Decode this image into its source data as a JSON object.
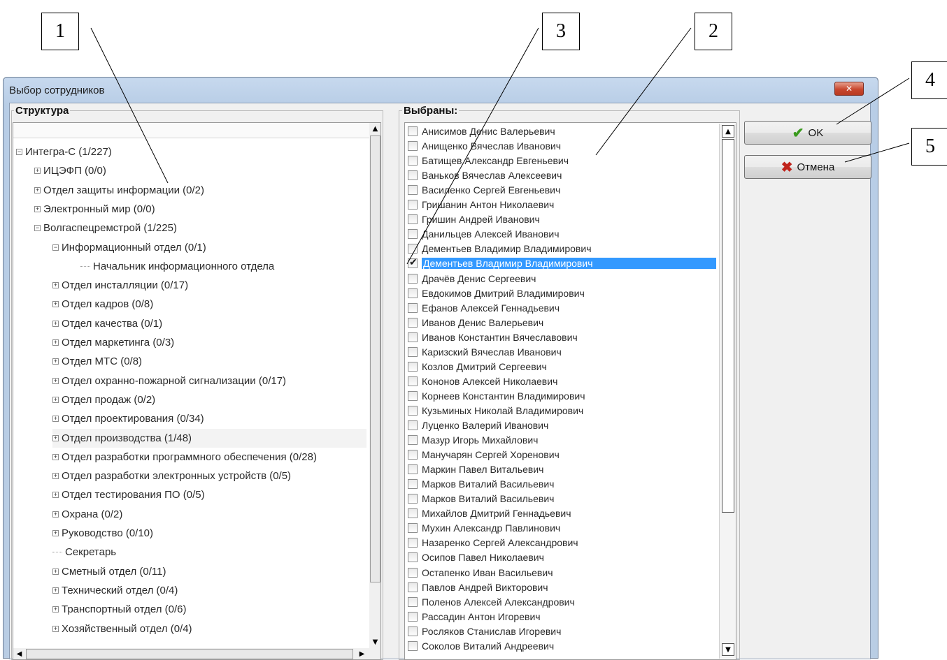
{
  "window": {
    "title": "Выбор сотрудников",
    "close_glyph": "✕"
  },
  "structure": {
    "label": "Структура",
    "items": [
      {
        "text": "Интегра-С (1/227)",
        "level": 0,
        "kind": "minus"
      },
      {
        "text": "ИЦЭФП (0/0)",
        "level": 1,
        "kind": "plus"
      },
      {
        "text": "Отдел  защиты информации (0/2)",
        "level": 1,
        "kind": "plus"
      },
      {
        "text": "Электронный мир (0/0)",
        "level": 1,
        "kind": "plus"
      },
      {
        "text": "Волгаспецремстрой (1/225)",
        "level": 1,
        "kind": "minus"
      },
      {
        "text": "Информационный отдел (0/1)",
        "level": 2,
        "kind": "minus"
      },
      {
        "text": "Начальник информационного отдела",
        "level": 3,
        "kind": "leaf"
      },
      {
        "text": "Отдел инсталляции (0/17)",
        "level": 2,
        "kind": "plus"
      },
      {
        "text": "Отдел кадров (0/8)",
        "level": 2,
        "kind": "plus"
      },
      {
        "text": "Отдел качества (0/1)",
        "level": 2,
        "kind": "plus"
      },
      {
        "text": "Отдел маркетинга (0/3)",
        "level": 2,
        "kind": "plus"
      },
      {
        "text": "Отдел МТС (0/8)",
        "level": 2,
        "kind": "plus"
      },
      {
        "text": "Отдел охранно-пожарной сигнализации (0/17)",
        "level": 2,
        "kind": "plus"
      },
      {
        "text": "Отдел продаж (0/2)",
        "level": 2,
        "kind": "plus"
      },
      {
        "text": "Отдел проектирования (0/34)",
        "level": 2,
        "kind": "plus"
      },
      {
        "text": "Отдел производства (1/48)",
        "level": 2,
        "kind": "plus",
        "highlighted": true
      },
      {
        "text": "Отдел разработки программного обеспечения (0/28)",
        "level": 2,
        "kind": "plus"
      },
      {
        "text": "Отдел разработки электронных устройств (0/5)",
        "level": 2,
        "kind": "plus"
      },
      {
        "text": "Отдел тестирования ПО (0/5)",
        "level": 2,
        "kind": "plus"
      },
      {
        "text": "Охрана (0/2)",
        "level": 2,
        "kind": "plus"
      },
      {
        "text": "Руководство (0/10)",
        "level": 2,
        "kind": "plus"
      },
      {
        "text": "Секретарь",
        "level": 2,
        "kind": "leaf"
      },
      {
        "text": "Сметный отдел (0/11)",
        "level": 2,
        "kind": "plus"
      },
      {
        "text": "Технический отдел (0/4)",
        "level": 2,
        "kind": "plus"
      },
      {
        "text": "Транспортный  отдел (0/6)",
        "level": 2,
        "kind": "plus"
      },
      {
        "text": "Хозяйственный  отдел (0/4)",
        "level": 2,
        "kind": "plus"
      }
    ]
  },
  "selected": {
    "label": "Выбраны:",
    "items": [
      {
        "name": "Анисимов Денис Валерьевич",
        "checked": false,
        "selected": false
      },
      {
        "name": "Анищенко Вячеслав Иванович",
        "checked": false,
        "selected": false
      },
      {
        "name": "Батищев Александр Евгеньевич",
        "checked": false,
        "selected": false
      },
      {
        "name": "Ваньков Вячеслав Алексеевич",
        "checked": false,
        "selected": false
      },
      {
        "name": "Василенко Сергей Евгеньевич",
        "checked": false,
        "selected": false
      },
      {
        "name": "Гришанин Антон Николаевич",
        "checked": false,
        "selected": false
      },
      {
        "name": "Гришин Андрей Иванович",
        "checked": false,
        "selected": false
      },
      {
        "name": "Данильцев Алексей Иванович",
        "checked": false,
        "selected": false
      },
      {
        "name": "Дементьев Владимир Владимирович",
        "checked": false,
        "selected": false
      },
      {
        "name": "Дементьев Владимир Владимирович",
        "checked": true,
        "selected": true
      },
      {
        "name": "Драчёв Денис Сергеевич",
        "checked": false,
        "selected": false
      },
      {
        "name": "Евдокимов Дмитрий Владимирович",
        "checked": false,
        "selected": false
      },
      {
        "name": "Ефанов Алексей Геннадьевич",
        "checked": false,
        "selected": false
      },
      {
        "name": "Иванов Денис Валерьевич",
        "checked": false,
        "selected": false
      },
      {
        "name": "Иванов Константин Вячеславович",
        "checked": false,
        "selected": false
      },
      {
        "name": "Каризский Вячеслав Иванович",
        "checked": false,
        "selected": false
      },
      {
        "name": "Козлов Дмитрий  Сергеевич",
        "checked": false,
        "selected": false
      },
      {
        "name": "Кононов Алексей Николаевич",
        "checked": false,
        "selected": false
      },
      {
        "name": "Корнеев Константин Владимирович",
        "checked": false,
        "selected": false
      },
      {
        "name": "Кузьминых Николай Владимирович",
        "checked": false,
        "selected": false
      },
      {
        "name": "Луценко Валерий Иванович",
        "checked": false,
        "selected": false
      },
      {
        "name": "Мазур Игорь Михайлович",
        "checked": false,
        "selected": false
      },
      {
        "name": "Манучарян Сергей Хоренович",
        "checked": false,
        "selected": false
      },
      {
        "name": "Маркин Павел Витальевич",
        "checked": false,
        "selected": false
      },
      {
        "name": "Марков Виталий Васильевич",
        "checked": false,
        "selected": false
      },
      {
        "name": "Марков Виталий Васильевич",
        "checked": false,
        "selected": false
      },
      {
        "name": "Михайлов Дмитрий  Геннадьевич",
        "checked": false,
        "selected": false
      },
      {
        "name": "Мухин Александр Павлинович",
        "checked": false,
        "selected": false
      },
      {
        "name": "Назаренко Сергей Александрович",
        "checked": false,
        "selected": false
      },
      {
        "name": "Осипов Павел Николаевич",
        "checked": false,
        "selected": false
      },
      {
        "name": "Остапенко Иван Васильевич",
        "checked": false,
        "selected": false
      },
      {
        "name": "Павлов Андрей Викторович",
        "checked": false,
        "selected": false
      },
      {
        "name": "Поленов Алексей Александрович",
        "checked": false,
        "selected": false
      },
      {
        "name": "Рассадин Антон Игоревич",
        "checked": false,
        "selected": false
      },
      {
        "name": "Росляков Станислав Игоревич",
        "checked": false,
        "selected": false
      },
      {
        "name": "Соколов Виталий Андреевич",
        "checked": false,
        "selected": false
      }
    ]
  },
  "buttons": {
    "ok": {
      "label": "OK",
      "icon": "checkmark-icon",
      "icon_color": "#3a9a1e"
    },
    "cancel": {
      "label": "Отмена",
      "icon": "x-icon",
      "icon_color": "#c0231b"
    }
  },
  "callouts": [
    "1",
    "2",
    "3",
    "4",
    "5"
  ],
  "colors": {
    "selection": "#3399ff",
    "title_bar": "#c7d9ee"
  }
}
